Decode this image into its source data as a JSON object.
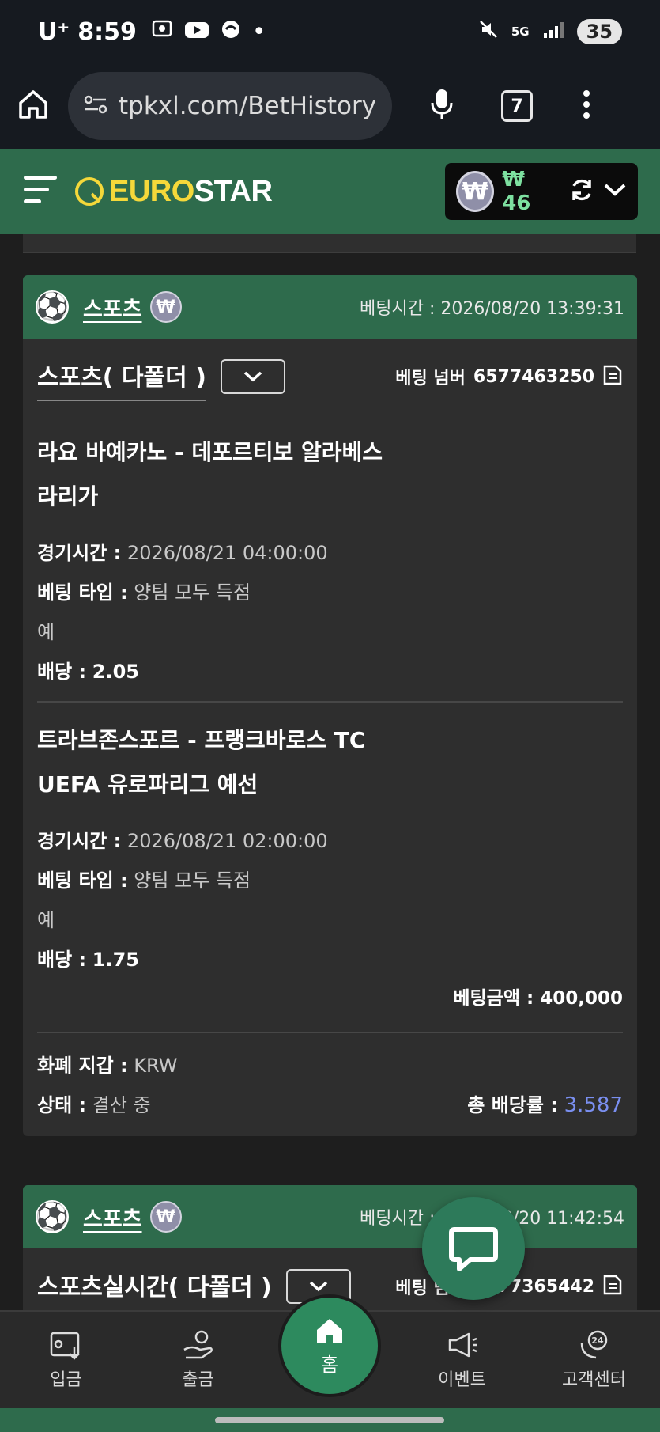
{
  "status_bar": {
    "carrier": "U⁺",
    "time": "8:59",
    "network": "5G",
    "battery": "35"
  },
  "browser": {
    "url": "tpkxl.com/BetHistory",
    "tab_count": "7"
  },
  "app_header": {
    "logo_euro": "EURO",
    "logo_star": "STAR",
    "currency_symbol": "₩",
    "balance": "₩ 46"
  },
  "bets": [
    {
      "category": "스포츠",
      "currency_symbol": "₩",
      "bet_time_label": "베팅시간 :",
      "bet_time": "2026/08/20 13:39:31",
      "bet_type": "스포츠( 다폴더 )",
      "bet_number_label": "베팅 넘버",
      "bet_number": "6577463250",
      "matches": [
        {
          "teams": "라요 바예카노 - 데포르티보 알라베스",
          "league": "라리가",
          "game_time_label": "경기시간 :",
          "game_time": "2026/08/21 04:00:00",
          "bet_kind_label": "베팅 타입 :",
          "bet_kind": "양팀 모두 득점",
          "pick": "예",
          "odds_label": "배당 :",
          "odds": "2.05"
        },
        {
          "teams": "트라브존스포르 - 프랭크바로스 TC",
          "league": "UEFA 유로파리그 예선",
          "game_time_label": "경기시간 :",
          "game_time": "2026/08/21 02:00:00",
          "bet_kind_label": "베팅 타입 :",
          "bet_kind": "양팀 모두 득점",
          "pick": "예",
          "odds_label": "배당 :",
          "odds": "1.75"
        }
      ],
      "amount_label": "베팅금액 :",
      "amount": "400,000",
      "wallet_label": "화폐 지갑 :",
      "wallet": "KRW",
      "status_label": "상태 :",
      "status": "결산 중",
      "total_ratio_label": "총 배당률 :",
      "total_ratio": "3.587"
    },
    {
      "category": "스포츠",
      "currency_symbol": "₩",
      "bet_time_label": "베팅시간 :",
      "bet_time": "2026/08/20 11:42:54",
      "bet_type": "스포츠실시간( 다폴더 )",
      "bet_number_label": "베팅 넘버",
      "bet_number": "6577365442"
    }
  ],
  "bottom_nav": {
    "deposit": "입금",
    "withdraw": "출금",
    "home": "홈",
    "event": "이벤트",
    "support": "고객센터"
  }
}
